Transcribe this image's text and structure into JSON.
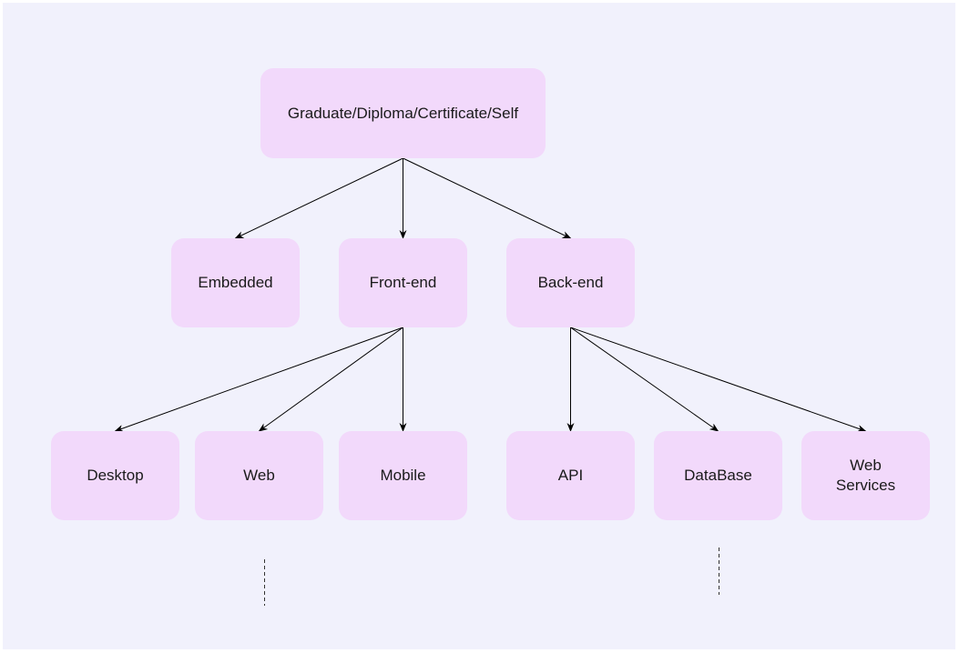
{
  "diagram": {
    "type": "tree",
    "nodes": [
      {
        "id": "root",
        "label": "Graduate/Diploma/Certificate/Self"
      },
      {
        "id": "embedded",
        "label": "Embedded"
      },
      {
        "id": "frontend",
        "label": "Front-end"
      },
      {
        "id": "backend",
        "label": "Back-end"
      },
      {
        "id": "desktop",
        "label": "Desktop"
      },
      {
        "id": "web",
        "label": "Web"
      },
      {
        "id": "mobile",
        "label": "Mobile"
      },
      {
        "id": "api",
        "label": "API"
      },
      {
        "id": "database",
        "label": "DataBase"
      },
      {
        "id": "webservices",
        "label": "Web Services"
      }
    ],
    "edges": [
      {
        "from": "root",
        "to": "embedded",
        "style": "arrow"
      },
      {
        "from": "root",
        "to": "frontend",
        "style": "arrow"
      },
      {
        "from": "root",
        "to": "backend",
        "style": "arrow"
      },
      {
        "from": "frontend",
        "to": "desktop",
        "style": "arrow"
      },
      {
        "from": "frontend",
        "to": "web",
        "style": "arrow"
      },
      {
        "from": "frontend",
        "to": "mobile",
        "style": "arrow"
      },
      {
        "from": "backend",
        "to": "api",
        "style": "arrow"
      },
      {
        "from": "backend",
        "to": "database",
        "style": "arrow"
      },
      {
        "from": "backend",
        "to": "webservices",
        "style": "arrow"
      }
    ],
    "continuations": [
      {
        "below": "web",
        "style": "dashed"
      },
      {
        "below": "database",
        "style": "dashed"
      }
    ],
    "colors": {
      "background": "#f1f1fc",
      "node_fill": "#f2d9fb",
      "edge": "#000000",
      "text": "#1a1a1a"
    }
  }
}
